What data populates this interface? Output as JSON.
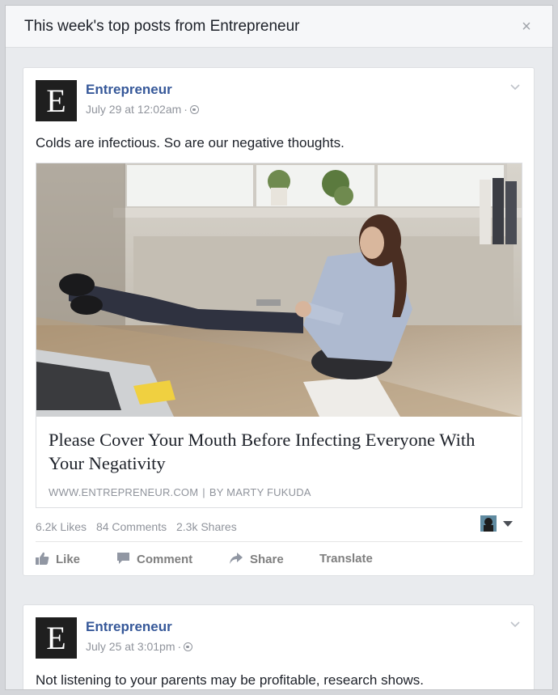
{
  "dialog": {
    "title": "This week's top posts from Entrepreneur",
    "close_icon": "×"
  },
  "posts": [
    {
      "logo_letter": "E",
      "author": "Entrepreneur",
      "date": "July 29 at 12:02am",
      "separator": "·",
      "text": "Colds are infectious. So are our negative thoughts.",
      "link": {
        "title": "Please Cover Your Mouth Before Infecting Everyone With Your Negativity",
        "domain": "WWW.ENTREPRENEUR.COM",
        "divider": "|",
        "byline": "BY MARTY FUKUDA"
      },
      "stats": {
        "likes": "6.2k Likes",
        "comments": "84 Comments",
        "shares": "2.3k Shares"
      },
      "actions": {
        "like": "Like",
        "comment": "Comment",
        "share": "Share",
        "translate": "Translate"
      }
    },
    {
      "logo_letter": "E",
      "author": "Entrepreneur",
      "date": "July 25 at 3:01pm",
      "separator": "·",
      "text": "Not listening to your parents may be profitable, research shows."
    }
  ],
  "icons": {
    "close": "close-icon",
    "globe": "globe-icon",
    "chevron": "chevron-down-icon",
    "like": "thumbs-up-icon",
    "comment": "comment-bubble-icon",
    "share": "share-arrow-icon"
  },
  "colors": {
    "link_blue": "#365899",
    "muted_gray": "#90949c",
    "background": "#e9ebee"
  }
}
